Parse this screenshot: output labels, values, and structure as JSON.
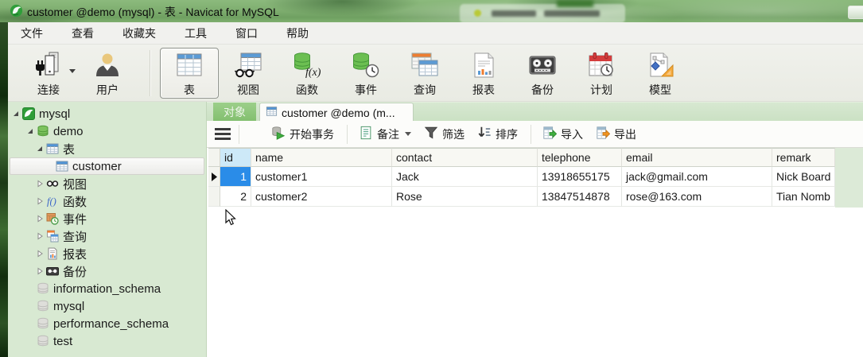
{
  "window": {
    "title": "customer @demo (mysql) - 表 - Navicat for MySQL",
    "minimize_label": ""
  },
  "menu": {
    "items": [
      "文件",
      "查看",
      "收藏夹",
      "工具",
      "窗口",
      "帮助"
    ]
  },
  "main_toolbar": {
    "items": [
      {
        "label": "连接",
        "icon": "connection-icon",
        "has_dropdown": true
      },
      {
        "label": "用户",
        "icon": "user-icon"
      },
      {
        "label": "表",
        "icon": "table-icon",
        "selected": true
      },
      {
        "label": "视图",
        "icon": "view-icon"
      },
      {
        "label": "函数",
        "icon": "function-icon"
      },
      {
        "label": "事件",
        "icon": "event-icon"
      },
      {
        "label": "查询",
        "icon": "query-icon"
      },
      {
        "label": "报表",
        "icon": "report-icon"
      },
      {
        "label": "备份",
        "icon": "backup-icon"
      },
      {
        "label": "计划",
        "icon": "schedule-icon"
      },
      {
        "label": "模型",
        "icon": "model-icon"
      }
    ]
  },
  "sidebar": {
    "items": [
      {
        "label": "mysql",
        "level": 1,
        "state": "expanded",
        "icon": "mysql-connection-icon"
      },
      {
        "label": "demo",
        "level": 2,
        "state": "expanded",
        "icon": "database-green-icon"
      },
      {
        "label": "表",
        "level": 3,
        "state": "expanded",
        "icon": "table-icon"
      },
      {
        "label": "customer",
        "level": 4,
        "state": "none",
        "icon": "table-icon",
        "selected": true
      },
      {
        "label": "视图",
        "level": 3,
        "state": "collapsed",
        "icon": "view-icon"
      },
      {
        "label": "函数",
        "level": 3,
        "state": "collapsed",
        "icon": "function-icon"
      },
      {
        "label": "事件",
        "level": 3,
        "state": "collapsed",
        "icon": "event-icon"
      },
      {
        "label": "查询",
        "level": 3,
        "state": "collapsed",
        "icon": "query-icon"
      },
      {
        "label": "报表",
        "level": 3,
        "state": "collapsed",
        "icon": "report-icon"
      },
      {
        "label": "备份",
        "level": 3,
        "state": "collapsed",
        "icon": "backup-icon"
      },
      {
        "label": "information_schema",
        "level": 2,
        "state": "none",
        "icon": "database-gray-icon"
      },
      {
        "label": "mysql",
        "level": 2,
        "state": "none",
        "icon": "database-gray-icon"
      },
      {
        "label": "performance_schema",
        "level": 2,
        "state": "none",
        "icon": "database-gray-icon"
      },
      {
        "label": "test",
        "level": 2,
        "state": "none",
        "icon": "database-gray-icon"
      }
    ]
  },
  "tabs": [
    {
      "label": "对象",
      "active": false
    },
    {
      "label": "customer @demo (m...",
      "active": true
    }
  ],
  "grid_toolbar": {
    "begin_transaction": "开始事务",
    "memo": "备注",
    "filter": "筛选",
    "sort": "排序",
    "import": "导入",
    "export": "导出"
  },
  "table": {
    "columns": [
      "id",
      "name",
      "contact",
      "telephone",
      "email",
      "remark"
    ],
    "rows": [
      [
        "1",
        "customer1",
        "Jack",
        "13918655175",
        "jack@gmail.com",
        "Nick Board"
      ],
      [
        "2",
        "customer2",
        "Rose",
        "13847514878",
        "rose@163.com",
        "Tian Nomb"
      ]
    ],
    "selected_cell": {
      "row": 0,
      "column": "id",
      "value": "1"
    }
  },
  "colors": {
    "titlebar_green": "#7fae70",
    "sidebar_bg": "#d8e9d2",
    "tab_green": "#8cc77b",
    "selection_blue": "#2a8ce8",
    "selected_column_header": "#cde9f8",
    "grid_filler_green": "#dcead7"
  }
}
